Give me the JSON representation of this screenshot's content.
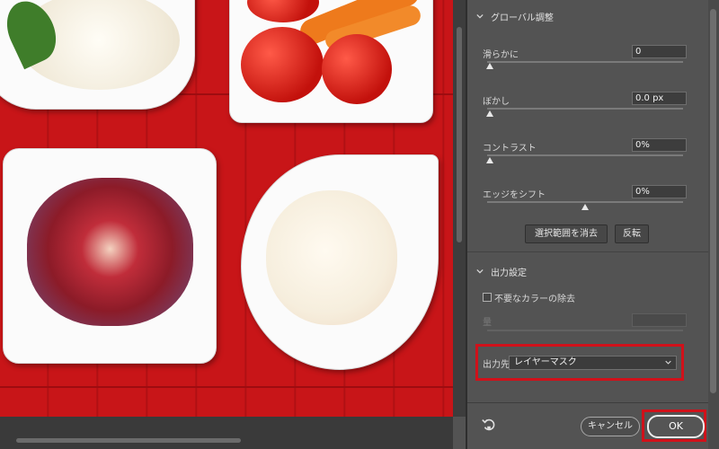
{
  "global_section": {
    "title": "グローバル調整"
  },
  "smooth": {
    "label": "滑らかに",
    "value": "0",
    "level": 0
  },
  "feather": {
    "label": "ぼかし",
    "value": "0.0 px",
    "level": 0
  },
  "contrast": {
    "label": "コントラスト",
    "value": "0%",
    "level": 0
  },
  "shift_edge": {
    "label": "エッジをシフト",
    "value": "0%",
    "level": 0.5
  },
  "buttons": {
    "clear_selection": "選択範囲を消去",
    "invert": "反転",
    "cancel": "キャンセル",
    "ok": "OK"
  },
  "output_section": {
    "title": "出力設定"
  },
  "decontaminate": {
    "label": "不要なカラーの除去",
    "checked": false
  },
  "amount": {
    "label": "量"
  },
  "output_to": {
    "label": "出力先",
    "value": "レイヤーマスク"
  },
  "colors": {
    "panel": "#535353",
    "highlight": "#d0111a",
    "table_red": "#c81518"
  },
  "icons": [
    "chevron-down-icon",
    "reset-icon",
    "dropdown-caret-icon"
  ]
}
